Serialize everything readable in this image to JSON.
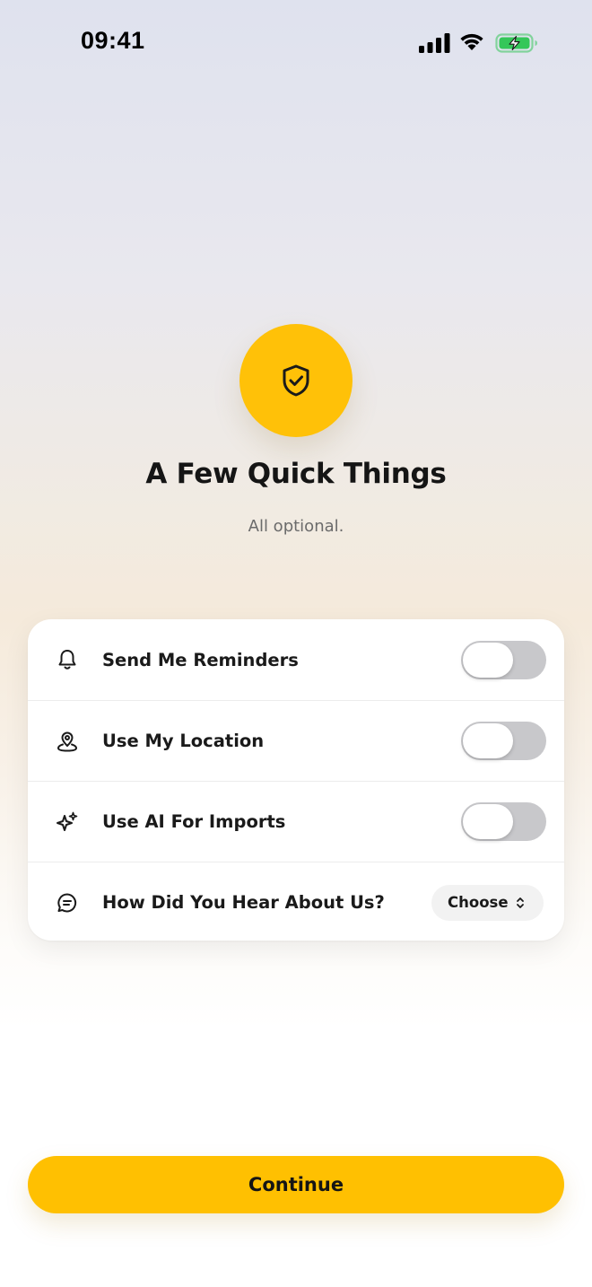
{
  "status_bar": {
    "time": "09:41",
    "icons": [
      "signal-bars-icon",
      "wifi-icon",
      "battery-charging-icon"
    ],
    "battery_color": "#34c759"
  },
  "hero": {
    "icon": "shield-check-icon",
    "accent_color": "#ffc108"
  },
  "title": "A Few Quick Things",
  "subtitle": "All optional.",
  "settings": {
    "items": [
      {
        "icon": "bell-icon",
        "label": "Send Me Reminders",
        "control": "toggle",
        "enabled": false
      },
      {
        "icon": "location-pin-icon",
        "label": "Use My Location",
        "control": "toggle",
        "enabled": false
      },
      {
        "icon": "sparkles-icon",
        "label": "Use AI For Imports",
        "control": "toggle",
        "enabled": false
      },
      {
        "icon": "chat-bubble-icon",
        "label": "How Did You Hear About Us?",
        "control": "select",
        "selected": "Choose"
      }
    ]
  },
  "continue_label": "Continue"
}
